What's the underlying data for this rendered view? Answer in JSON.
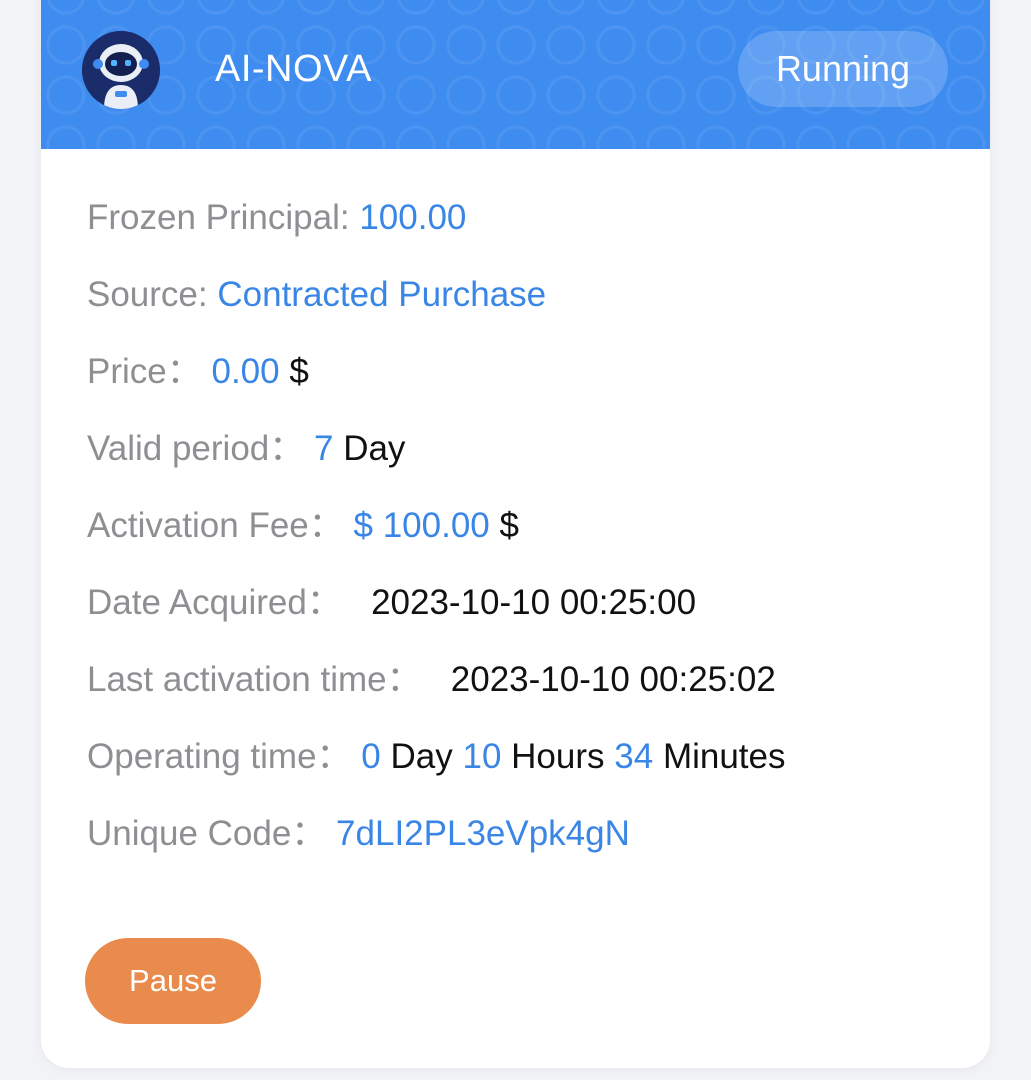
{
  "header": {
    "title": "AI-NOVA",
    "status": "Running",
    "avatar_icon": "robot-astronaut-icon",
    "brand_color": "#3f8cf0"
  },
  "details": {
    "frozen_principal": {
      "label": "Frozen Principal: ",
      "value": "100.00"
    },
    "source": {
      "label": "Source: ",
      "value": "Contracted Purchase"
    },
    "price": {
      "label": "Price：",
      "value": "0.00",
      "unit": "$"
    },
    "valid_period": {
      "label": "Valid period：",
      "value": "7",
      "unit": "Day"
    },
    "activation_fee": {
      "label": "Activation Fee：",
      "value": "$ 100.00",
      "unit": "$"
    },
    "date_acquired": {
      "label": "Date Acquired：",
      "value": "2023-10-10 00:25:00"
    },
    "last_activation": {
      "label": "Last activation time：",
      "value": "2023-10-10 00:25:02"
    },
    "operating_time": {
      "label": "Operating time：",
      "days": "0",
      "days_unit": "Day",
      "hours": "10",
      "hours_unit": "Hours",
      "minutes": "34",
      "minutes_unit": "Minutes"
    },
    "unique_code": {
      "label": "Unique Code：",
      "value": "7dLI2PL3eVpk4gN"
    }
  },
  "actions": {
    "pause_label": "Pause",
    "pause_color": "#e98b4c"
  }
}
